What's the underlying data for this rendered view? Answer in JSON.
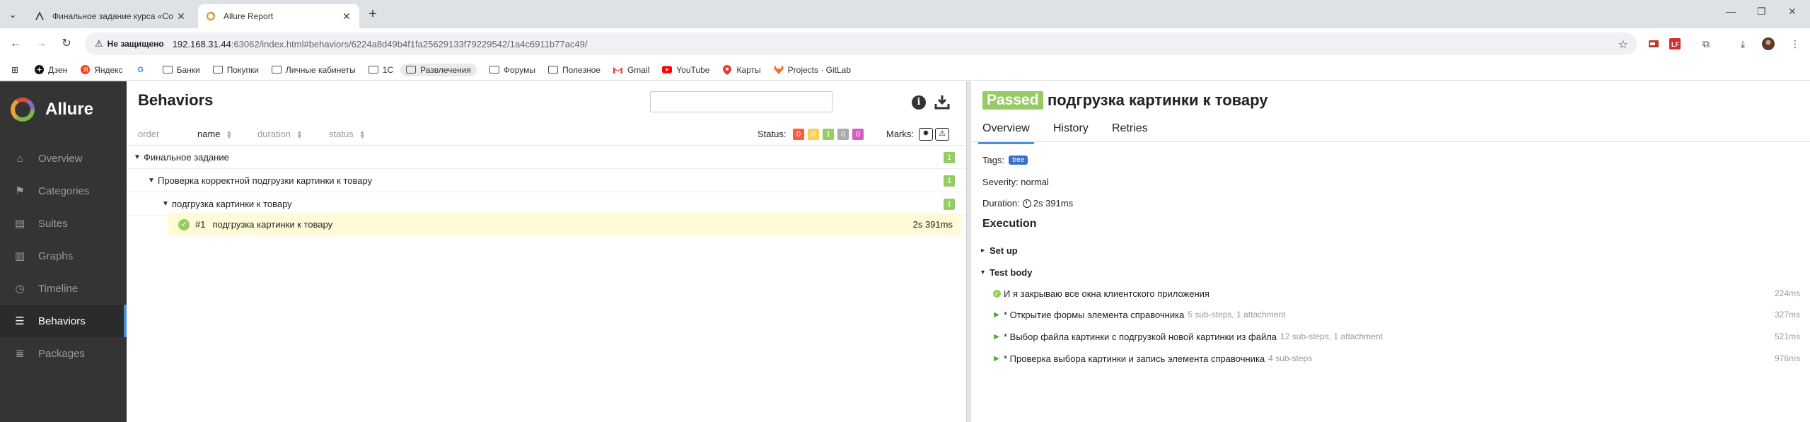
{
  "browser": {
    "tabs": [
      {
        "title": "Финальное задание курса «Со",
        "active": false
      },
      {
        "title": "Allure Report",
        "active": true
      }
    ],
    "security_label": "Не защищено",
    "url_host": "192.168.31.44",
    "url_rest": ":63062/index.html#behaviors/6224a8d49b4f1fa25629133f79229542/1a4c6911b77ac49/",
    "bookmarks": [
      "Дзен",
      "Яндекс",
      "Банки",
      "Покупки",
      "Личные кабинеты",
      "1С",
      "Развлечения",
      "Форумы",
      "Полезное",
      "Gmail",
      "YouTube",
      "Карты",
      "Projects · GitLab"
    ]
  },
  "sidebar": {
    "brand": "Allure",
    "items": [
      {
        "label": "Overview",
        "icon": "home-icon"
      },
      {
        "label": "Categories",
        "icon": "flag-icon"
      },
      {
        "label": "Suites",
        "icon": "briefcase-icon"
      },
      {
        "label": "Graphs",
        "icon": "bar-chart-icon"
      },
      {
        "label": "Timeline",
        "icon": "clock-icon"
      },
      {
        "label": "Behaviors",
        "icon": "list-icon",
        "active": true
      },
      {
        "label": "Packages",
        "icon": "packages-icon"
      }
    ]
  },
  "behaviors": {
    "title": "Behaviors",
    "search_value": "",
    "columns": {
      "order": "order",
      "name": "name",
      "duration": "duration",
      "status": "status"
    },
    "status_label": "Status:",
    "status_counts": {
      "failed": "0",
      "broken": "0",
      "passed": "1",
      "skipped": "0",
      "unknown": "0"
    },
    "marks_label": "Marks:",
    "tree": [
      {
        "label": "Финальное задание",
        "count": "1"
      },
      {
        "label": "Проверка корректной подгрузки картинки к товару",
        "count": "1"
      },
      {
        "label": "подгрузка картинки к товару",
        "count": "1"
      }
    ],
    "leaf": {
      "num": "#1",
      "label": "подгрузка картинки к товару",
      "duration": "2s 391ms"
    }
  },
  "testcase": {
    "status": "Passed",
    "title": "подгрузка картинки к товару",
    "tabs": [
      "Overview",
      "History",
      "Retries"
    ],
    "tags_label": "Tags:",
    "tag": "tree",
    "severity": "Severity: normal",
    "duration_label": "Duration:",
    "duration": "2s 391ms",
    "execution": "Execution",
    "setup": "Set up",
    "test_body": "Test body",
    "steps": [
      {
        "name": "И я закрываю все окна клиентского приложения",
        "sub": "",
        "duration": "224ms",
        "kind": "ok"
      },
      {
        "name": "* Открытие формы элемента справочника",
        "sub": "5 sub-steps, 1 attachment",
        "duration": "327ms",
        "kind": "expand"
      },
      {
        "name": "* Выбор файла картинки с подгрузкой новой картинки из файла",
        "sub": "12 sub-steps, 1 attachment",
        "duration": "521ms",
        "kind": "expand"
      },
      {
        "name": "* Проверка выбора картинки и запись элемента справочника",
        "sub": "4 sub-steps",
        "duration": "976ms",
        "kind": "expand"
      }
    ]
  }
}
